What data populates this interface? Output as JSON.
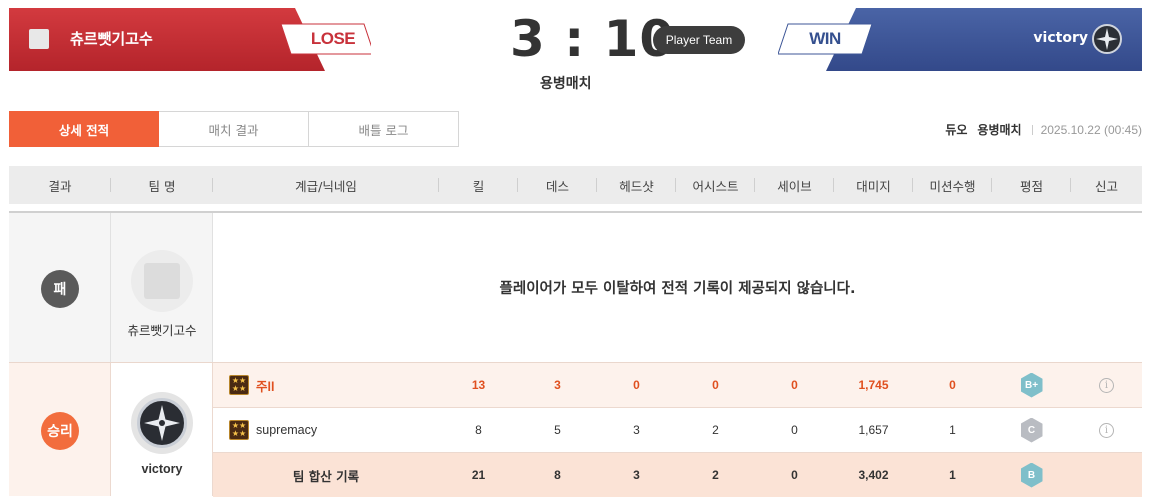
{
  "header": {
    "losing_team": {
      "name": "츄르뺏기고수",
      "result": "LOSE"
    },
    "winning_team": {
      "name": "victory",
      "result": "WIN"
    },
    "score": "3 : 10",
    "player_team_badge": "Player Team",
    "mode": "용병매치"
  },
  "tabs": [
    {
      "label": "상세 전적",
      "active": true
    },
    {
      "label": "매치 결과",
      "active": false
    },
    {
      "label": "배틀 로그",
      "active": false
    }
  ],
  "match_info": {
    "type": "듀오",
    "mode": "용병매치",
    "date": "2025.10.22 (00:45)"
  },
  "columns": [
    "결과",
    "팀 명",
    "계급/닉네임",
    "킬",
    "데스",
    "헤드샷",
    "어시스트",
    "세이브",
    "대미지",
    "미션수행",
    "평점",
    "신고"
  ],
  "lose_block": {
    "result": "패",
    "team_name": "츄르뺏기고수",
    "message": "플레이어가 모두 이탈하여 전적 기록이 제공되지 않습니다."
  },
  "win_block": {
    "result": "승리",
    "team_name": "victory",
    "players": [
      {
        "nickname": "주ll",
        "kill": "13",
        "death": "3",
        "headshot": "0",
        "assist": "0",
        "save": "0",
        "damage": "1,745",
        "mission": "0",
        "grade": "B+",
        "highlight": true
      },
      {
        "nickname": "supremacy",
        "kill": "8",
        "death": "5",
        "headshot": "3",
        "assist": "2",
        "save": "0",
        "damage": "1,657",
        "mission": "1",
        "grade": "C",
        "highlight": false
      }
    ],
    "total": {
      "label": "팀 합산 기록",
      "kill": "21",
      "death": "8",
      "headshot": "3",
      "assist": "2",
      "save": "0",
      "damage": "3,402",
      "mission": "1",
      "grade": "B"
    }
  },
  "icons": {
    "rank": "rank-star-icon",
    "info": "info-icon",
    "victory_emblem": "compass-star-emblem-icon",
    "lose_emblem": "default-clan-emblem-icon"
  },
  "colors": {
    "lose_red": "#c8323b",
    "win_blue": "#3d5697",
    "accent_orange": "#f16038"
  }
}
